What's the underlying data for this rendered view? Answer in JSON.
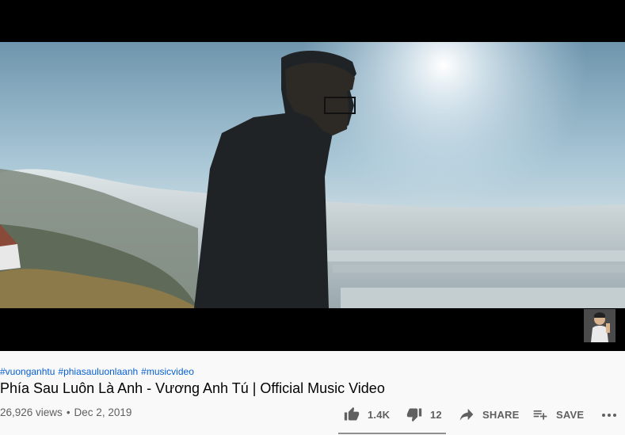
{
  "video": {
    "hashtags": [
      "#vuonganhtu",
      "#phiasauluonlaanh",
      "#musicvideo"
    ],
    "title": "Phía Sau Luôn Là Anh - Vương Anh Tú | Official Music Video",
    "views": "26,926 views",
    "separator": "•",
    "date": "Dec 2, 2019"
  },
  "actions": {
    "like_count": "1.4K",
    "dislike_count": "12",
    "share_label": "SHARE",
    "save_label": "SAVE"
  },
  "colors": {
    "link": "#065fd4",
    "text": "#030303",
    "secondary": "#606060",
    "background": "#f9f9f9"
  }
}
